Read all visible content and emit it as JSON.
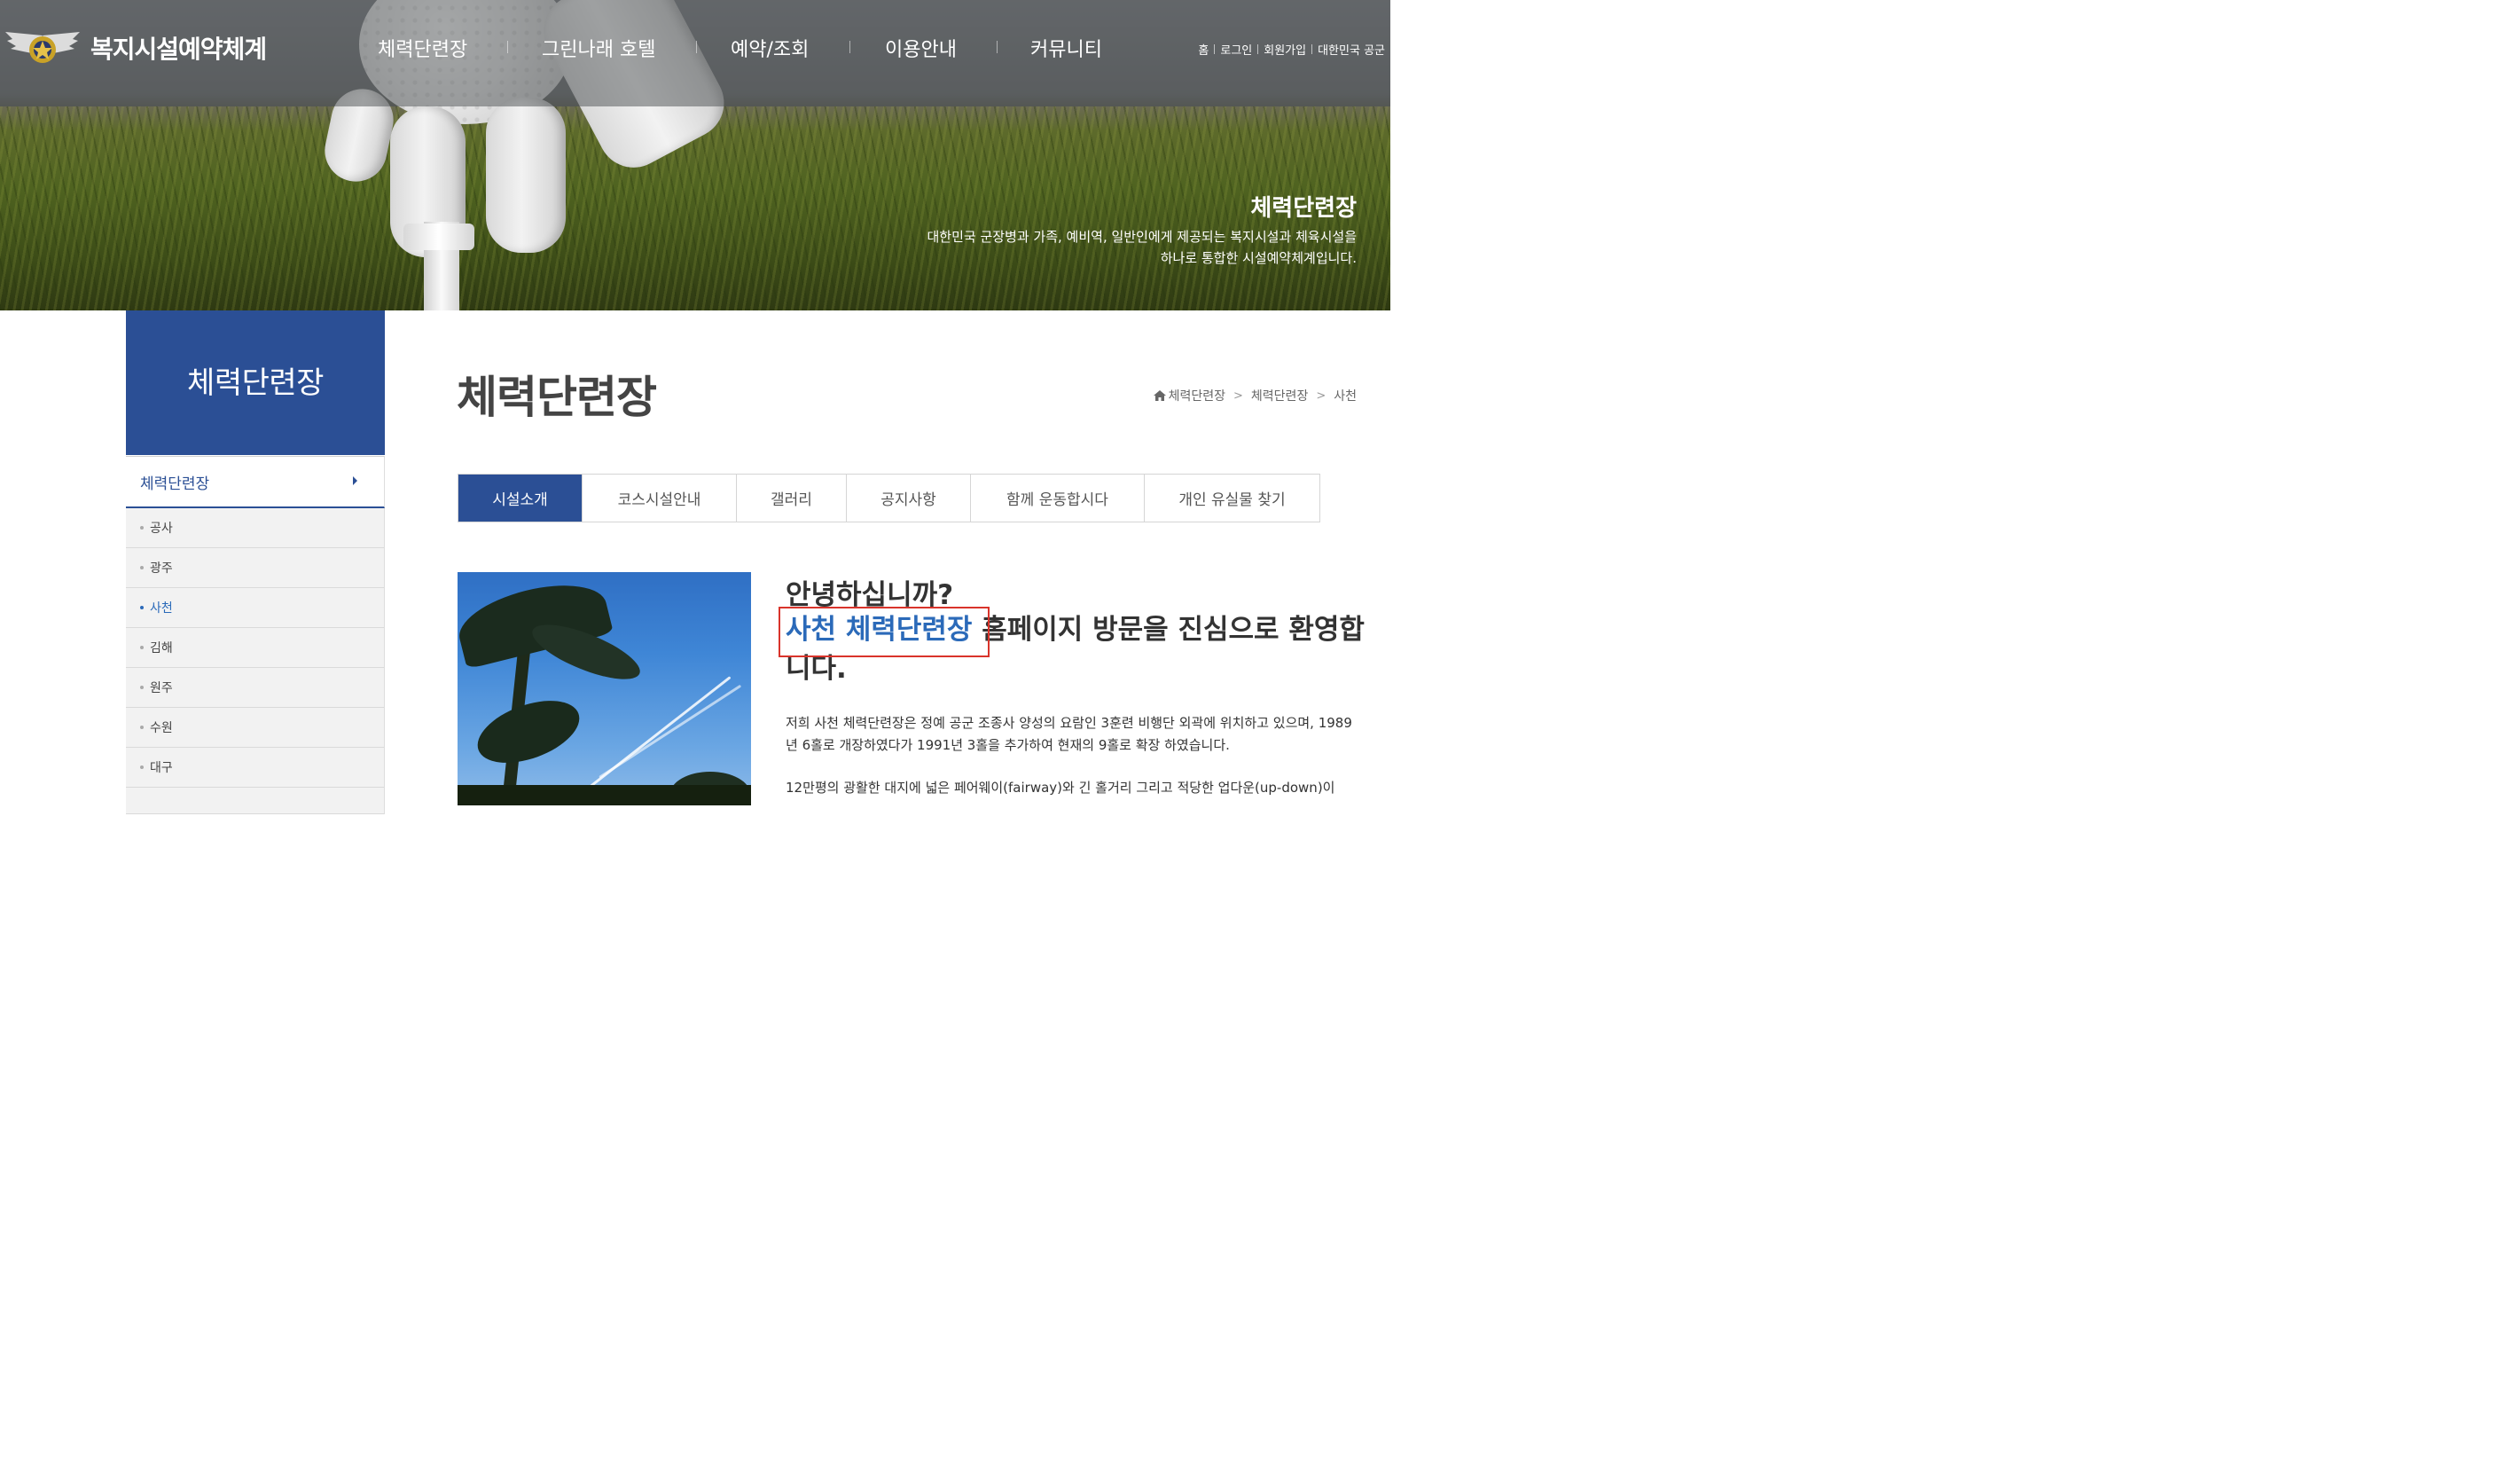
{
  "header": {
    "site_title": "복지시설예약체계",
    "nav": [
      "체력단련장",
      "그린나래 호텔",
      "예약/조회",
      "이용안내",
      "커뮤니티"
    ],
    "util_links": [
      "홈",
      "로그인",
      "회원가입",
      "대한민국 공군"
    ]
  },
  "hero": {
    "title": "체력단련장",
    "desc_line1": "대한민국 군장병과 가족, 예비역, 일반인에게 제공되는 복지시설과 체육시설을",
    "desc_line2": "하나로 통합한 시설예약체계입니다."
  },
  "sidebar": {
    "title": "체력단련장",
    "active_section": "체력단련장",
    "items": [
      {
        "label": "공사",
        "active": false
      },
      {
        "label": "광주",
        "active": false
      },
      {
        "label": "사천",
        "active": true
      },
      {
        "label": "김해",
        "active": false
      },
      {
        "label": "원주",
        "active": false
      },
      {
        "label": "수원",
        "active": false
      },
      {
        "label": "대구",
        "active": false
      }
    ]
  },
  "main": {
    "page_title": "체력단련장",
    "breadcrumb": [
      "체력단련장",
      "체력단련장",
      "사천"
    ],
    "tabs": [
      "시설소개",
      "코스시설안내",
      "갤러리",
      "공지사항",
      "함께 운동합시다",
      "개인 유실물 찾기"
    ],
    "active_tab": "시설소개",
    "welcome_line1": "안녕하십니까?",
    "welcome_highlight": "사천 체력단련장",
    "welcome_rest": " 홈페이지 방문을 진심으로 환영합니다.",
    "paragraph1": "저희 사천 체력단련장은 정예 공군 조종사 양성의 요람인 3훈련 비행단 외곽에 위치하고 있으며, 1989년 6홀로 개장하였다가 1991년 3홀을 추가하여 현재의 9홀로 확장 하였습니다.",
    "paragraph2": "12만평의 광활한 대지에 넓은 페어웨이(fairway)와 긴 홀거리 그리고 적당한 업다운(up-down)이"
  },
  "colors": {
    "primary": "#2b4f95",
    "highlight_text": "#2b6ab9",
    "annotation_box": "#d9342b"
  }
}
